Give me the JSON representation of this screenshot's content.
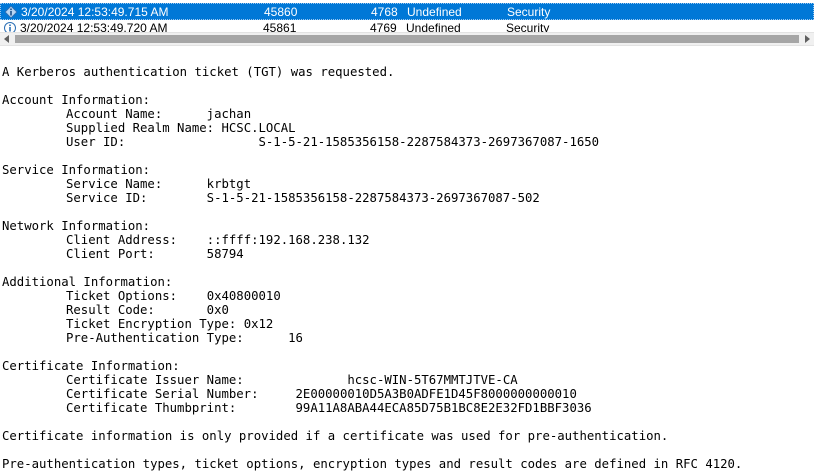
{
  "events": [
    {
      "date": "3/20/2024 12:53:49.715 AM",
      "event_id": "45860",
      "task": "4768",
      "level": "Undefined",
      "source": "Security"
    },
    {
      "date": "3/20/2024 12:53:49.720 AM",
      "event_id": "45861",
      "task": "4769",
      "level": "Undefined",
      "source": "Security"
    }
  ],
  "detail": {
    "summary": "A Kerberos authentication ticket (TGT) was requested.",
    "account": {
      "header": "Account Information:",
      "name_label": "Account Name:",
      "name_pad": "      ",
      "name": "jachan",
      "realm_label": "Supplied Realm Name:",
      "realm_pad": " ",
      "realm": "HCSC.LOCAL",
      "uid_label": "User ID:",
      "uid_pad": "                  ",
      "uid": "S-1-5-21-1585356158-2287584373-2697367087-1650"
    },
    "service": {
      "header": "Service Information:",
      "name_label": "Service Name:",
      "name_pad": "      ",
      "name": "krbtgt",
      "id_label": "Service ID:",
      "id_pad": "        ",
      "id": "S-1-5-21-1585356158-2287584373-2697367087-502"
    },
    "network": {
      "header": "Network Information:",
      "addr_label": "Client Address:",
      "addr_pad": "    ",
      "addr": "::ffff:192.168.238.132",
      "port_label": "Client Port:",
      "port_pad": "       ",
      "port": "58794"
    },
    "additional": {
      "header": "Additional Information:",
      "opts_label": "Ticket Options:",
      "opts_pad": "    ",
      "opts": "0x40800010",
      "result_label": "Result Code:",
      "result_pad": "       ",
      "result": "0x0",
      "enc_label": "Ticket Encryption Type:",
      "enc_pad": " ",
      "enc": "0x12",
      "preauth_label": "Pre-Authentication Type:",
      "preauth_pad": "      ",
      "preauth": "16"
    },
    "certificate": {
      "header": "Certificate Information:",
      "issuer_label": "Certificate Issuer Name:",
      "issuer_pad": "              ",
      "issuer": "hcsc-WIN-5T67MMTJTVE-CA",
      "serial_label": "Certificate Serial Number:",
      "serial_pad": "     ",
      "serial": "2E00000010D5A3B0ADFE1D45F8000000000010",
      "thumb_label": "Certificate Thumbprint:",
      "thumb_pad": "        ",
      "thumb": "99A11A8ABA44ECA85D75B1BC8E2E32FD1BBF3036"
    },
    "note1": "Certificate information is only provided if a certificate was used for pre-authentication.",
    "note2": "Pre-authentication types, ticket options, encryption types and result codes are defined in RFC 4120."
  }
}
